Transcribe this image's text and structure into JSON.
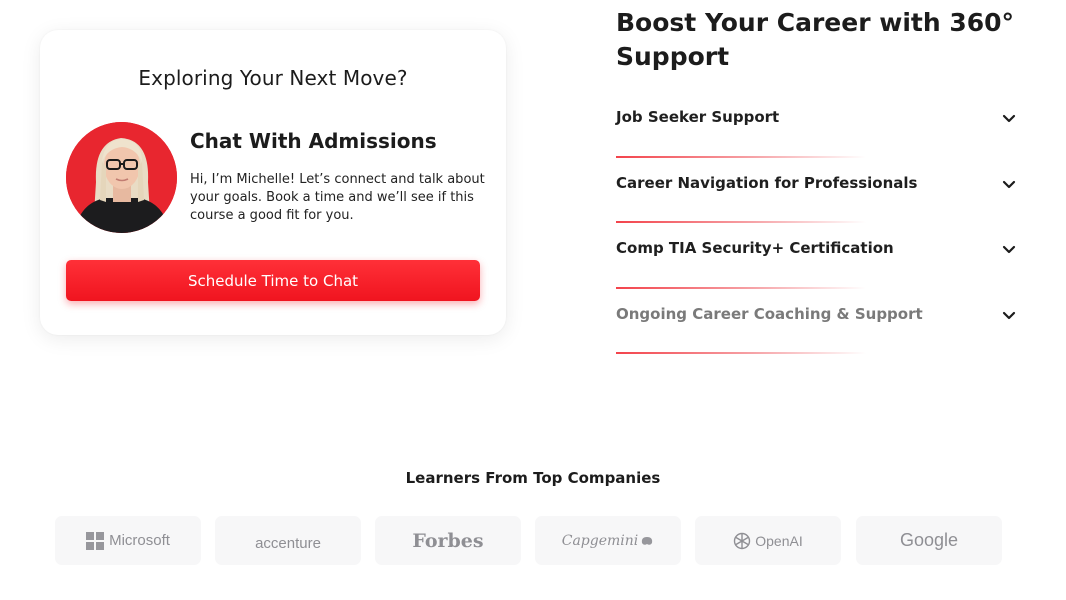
{
  "chat_card": {
    "title": "Exploring Your Next Move?",
    "heading": "Chat With Admissions",
    "text": "Hi, I’m Michelle! Let’s connect and talk about your goals. Book a time and we’ll see if this course a good fit for you.",
    "button_label": "Schedule Time to Chat"
  },
  "career": {
    "title": "Boost Your Career with 360° Support",
    "items": [
      {
        "label": "Job Seeker Support"
      },
      {
        "label": "Career Navigation for Professionals"
      },
      {
        "label": "Comp TIA Security+ Certification"
      },
      {
        "label": "Ongoing Career Coaching & Support"
      }
    ]
  },
  "companies": {
    "title": "Learners From Top Companies",
    "logos": [
      "Microsoft",
      "accenture",
      "Forbes",
      "Capgemini",
      "OpenAI",
      "Google"
    ]
  },
  "colors": {
    "accent": "#f0141f",
    "avatar_bg": "#e8262f",
    "logo_tile": "#f7f7f8",
    "logo_text": "#8f8f94"
  },
  "icons": {
    "accordion": "chevron-down-icon",
    "microsoft": "microsoft-grid-icon",
    "openai": "openai-knot-icon",
    "capgemini": "capgemini-spade-icon"
  }
}
